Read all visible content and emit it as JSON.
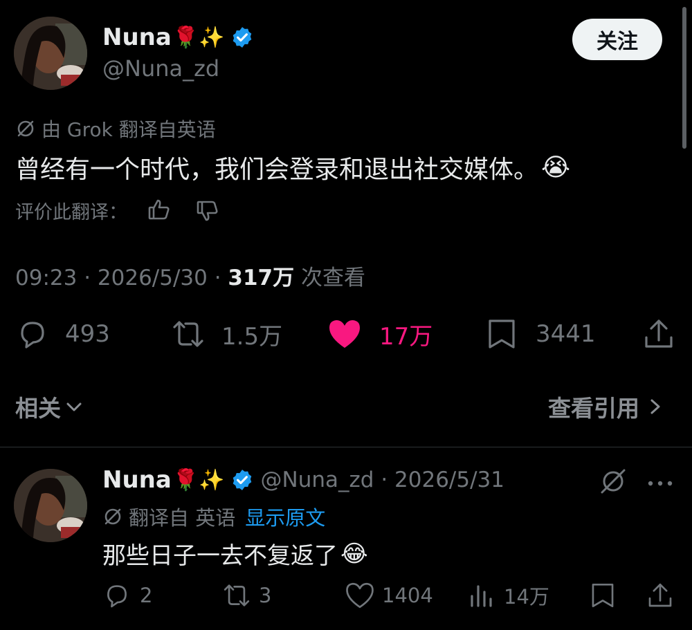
{
  "post": {
    "author_name": "Nuna",
    "author_emoji": "🌹✨",
    "handle": "@Nuna_zd",
    "follow_label": "关注",
    "translation_note": "由 Grok 翻译自英语",
    "text": "曾经有一个时代，我们会登录和退出社交媒体。",
    "text_emoji": "😭",
    "rate_translation_label": "评价此翻译：",
    "meta_time_date": "09:23 · 2026/5/30 · ",
    "views_count": "317万",
    "views_label": " 次查看",
    "stats": {
      "replies": "493",
      "reposts": "1.5万",
      "likes": "17万",
      "bookmarks": "3441"
    },
    "like_color": "#f91880"
  },
  "related": {
    "label": "相关",
    "view_quotes_label": "查看引用"
  },
  "reply": {
    "author_name": "Nuna",
    "author_emoji": "🌹✨",
    "handle_date": "@Nuna_zd · 2026/5/31",
    "translation_note": "翻译自 英语",
    "show_original_label": "显示原文",
    "text": "那些日子一去不复返了",
    "text_emoji": "😂",
    "stats": {
      "replies": "2",
      "reposts": "3",
      "likes": "1404",
      "views": "14万"
    }
  },
  "colors": {
    "background": "#000000",
    "text": "#e7e9ea",
    "muted": "#71767b",
    "link": "#1d9bf0",
    "verified": "#1d9bf0"
  },
  "icons": [
    "verified-badge-icon",
    "translate-icon",
    "thumbs-up-icon",
    "thumbs-down-icon",
    "reply-icon",
    "repost-icon",
    "heart-icon",
    "bookmark-icon",
    "share-icon",
    "chevron-down-icon",
    "chevron-right-icon",
    "grok-icon",
    "more-icon",
    "views-icon"
  ]
}
